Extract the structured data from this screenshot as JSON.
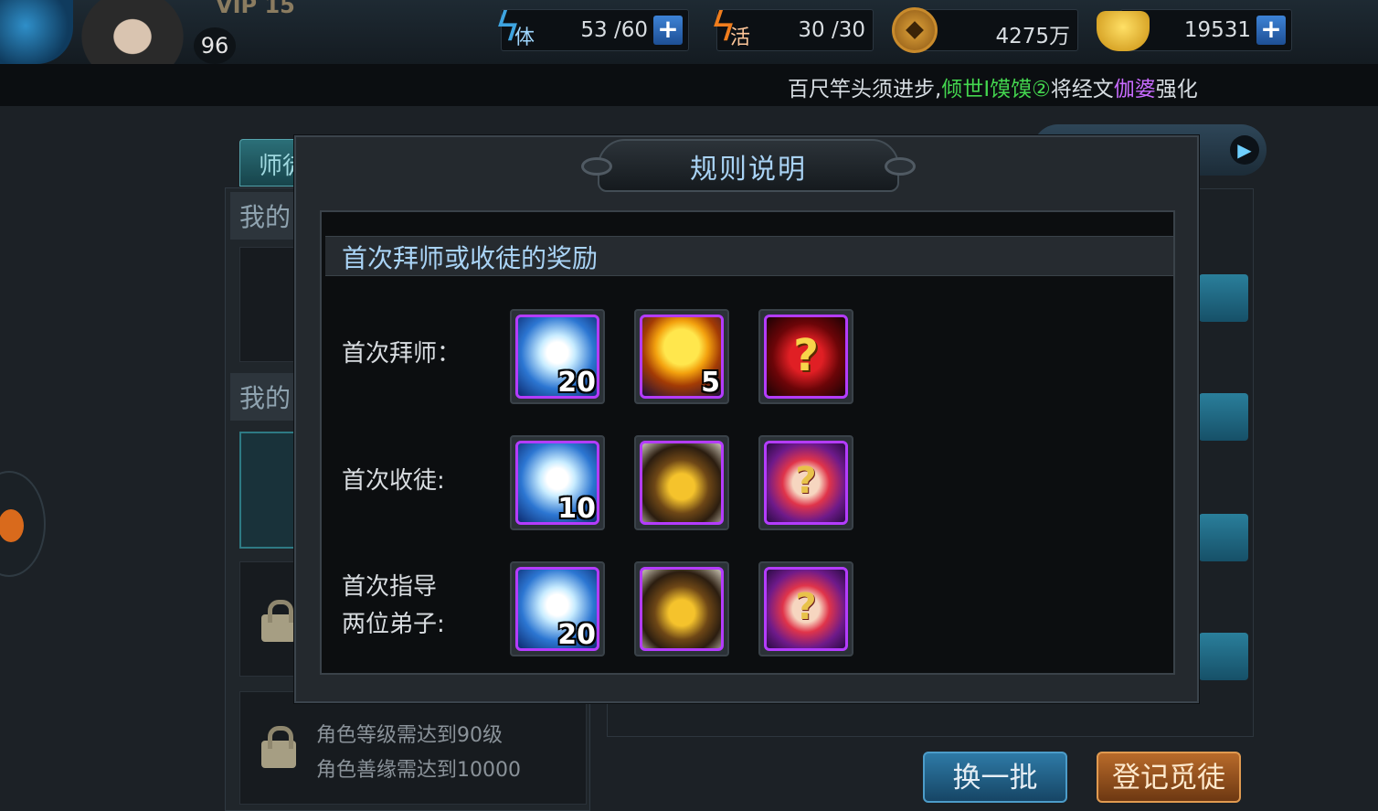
{
  "header": {
    "vip": "VIP 15",
    "level": "96",
    "stamina": {
      "label": "体",
      "value": "53 /60"
    },
    "vitality": {
      "label": "活",
      "value": "30 /30"
    },
    "coins": "4275万",
    "ingots": "19531",
    "plus": "+"
  },
  "ticker": {
    "part1": "百尺竿头须进步,",
    "part2": "倾世I馍馍②",
    "part3": "将经文",
    "part4": "伽婆",
    "part5": "强化"
  },
  "background": {
    "tab_shifu": "师徒",
    "my_label_1": "我的",
    "my_label_2": "我的",
    "req_level": "角色等级需达到90级",
    "req_karma": "角色善缘需达到10000",
    "btn_refresh": "换一批",
    "btn_register": "登记觅徒",
    "arrow": "▶"
  },
  "modal": {
    "title": "规则说明",
    "section_title": "首次拜师或收徒的奖励",
    "rows": [
      {
        "label_line1": "首次拜师：",
        "label_line2": "",
        "items": [
          {
            "icon": "spirit-orb-icon",
            "count": "20"
          },
          {
            "icon": "golden-sphere-icon",
            "count": "5"
          },
          {
            "icon": "mystery-weapon-icon",
            "count": ""
          }
        ]
      },
      {
        "label_line1": "首次收徒:",
        "label_line2": "",
        "items": [
          {
            "icon": "spirit-orb-icon",
            "count": "10"
          },
          {
            "icon": "treasure-chest-icon",
            "count": ""
          },
          {
            "icon": "mystery-scroll-icon",
            "count": ""
          }
        ]
      },
      {
        "label_line1": "首次指导",
        "label_line2": "两位弟子:",
        "items": [
          {
            "icon": "spirit-orb-icon",
            "count": "20"
          },
          {
            "icon": "treasure-chest-icon",
            "count": ""
          },
          {
            "icon": "mystery-scroll-icon",
            "count": ""
          }
        ]
      }
    ]
  }
}
